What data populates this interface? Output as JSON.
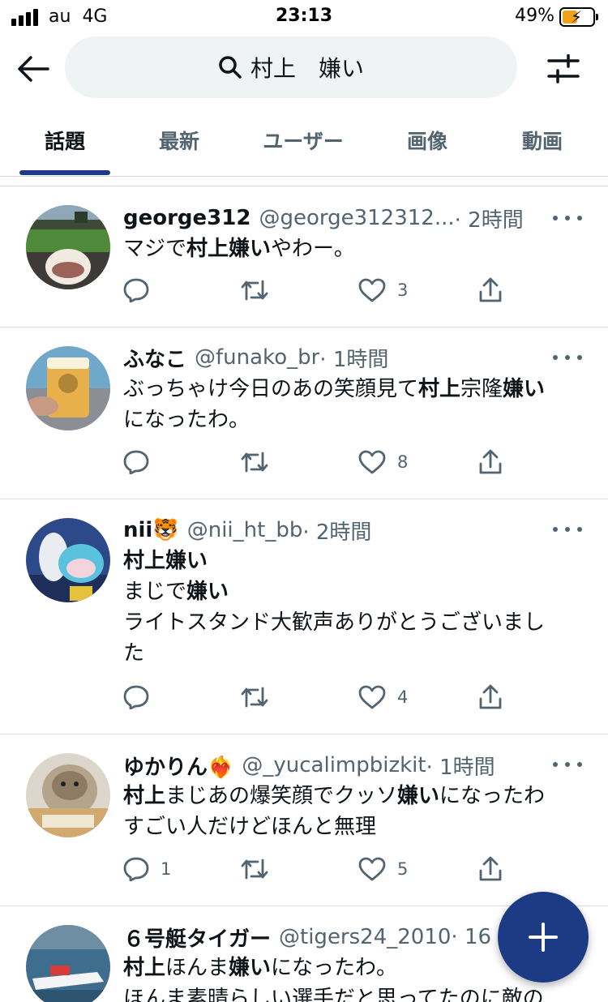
{
  "status_bar": {
    "carrier": "au",
    "network": "4G",
    "time": "23:13",
    "battery_percent": "49%",
    "battery_level": 0.49,
    "battery_color": "#f0a21b"
  },
  "header": {
    "back_icon": "arrow-left-icon",
    "search_icon": "search-icon",
    "search_query": "村上　嫌い",
    "filter_icon": "sliders-icon"
  },
  "tabs": [
    {
      "label": "話題",
      "active": true
    },
    {
      "label": "最新",
      "active": false
    },
    {
      "label": "ユーザー",
      "active": false
    },
    {
      "label": "画像",
      "active": false
    },
    {
      "label": "動画",
      "active": false
    }
  ],
  "accent_color": "#1d3b85",
  "tweets": [
    {
      "name": "george312",
      "handle": "@george312312...",
      "time": "· 2時間",
      "lines": [
        [
          {
            "t": "マジで",
            "b": false
          },
          {
            "t": "村上嫌い",
            "b": true
          },
          {
            "t": "やわー。",
            "b": false
          }
        ]
      ],
      "replies": "",
      "retweets": "",
      "likes": "3"
    },
    {
      "name": "ふなこ",
      "handle": "@funako_br",
      "time": "· 1時間",
      "lines": [
        [
          {
            "t": "ぶっちゃけ今日のあの笑顔見て",
            "b": false
          },
          {
            "t": "村上",
            "b": true
          },
          {
            "t": "宗隆",
            "b": false
          },
          {
            "t": "嫌い",
            "b": true
          }
        ],
        [
          {
            "t": "になったわ。",
            "b": false
          }
        ]
      ],
      "replies": "",
      "retweets": "",
      "likes": "8"
    },
    {
      "name": "nii🐯",
      "handle": "@nii_ht_bb",
      "time": "· 2時間",
      "lines": [
        [
          {
            "t": "村上嫌い",
            "b": true
          }
        ],
        [
          {
            "t": "まじで",
            "b": false
          },
          {
            "t": "嫌い",
            "b": true
          }
        ],
        [
          {
            "t": "ライトスタンド大歓声ありがとうございまし",
            "b": false
          }
        ],
        [
          {
            "t": "た",
            "b": false
          }
        ]
      ],
      "replies": "",
      "retweets": "",
      "likes": "4"
    },
    {
      "name": "ゆかりん❤️‍🔥",
      "handle": "@_yucalimpbizkit",
      "time": "· 1時間",
      "lines": [
        [
          {
            "t": "村上",
            "b": true
          },
          {
            "t": "まじあの爆笑顔でクッソ",
            "b": false
          },
          {
            "t": "嫌い",
            "b": true
          },
          {
            "t": "になったわ",
            "b": false
          }
        ],
        [
          {
            "t": "すごい人だけどほんと無理",
            "b": false
          }
        ]
      ],
      "replies": "1",
      "retweets": "",
      "likes": "5"
    },
    {
      "name": "６号艇タイガー",
      "handle": "@tigers24_2010",
      "time": "· 16",
      "lines": [
        [
          {
            "t": "村上",
            "b": true
          },
          {
            "t": "ほんま",
            "b": false
          },
          {
            "t": "嫌い",
            "b": true
          },
          {
            "t": "になったわ。",
            "b": false
          }
        ],
        [
          {
            "t": "ほんま素晴らしい選手だと思ってたのに敵の",
            "b": false
          }
        ]
      ],
      "replies": "",
      "retweets": "",
      "likes": ""
    }
  ],
  "icons": {
    "reply": "speech-bubble-icon",
    "retweet": "retweet-icon",
    "like": "heart-icon",
    "share": "share-icon",
    "more": "more-dots-icon",
    "compose": "plus-icon"
  }
}
